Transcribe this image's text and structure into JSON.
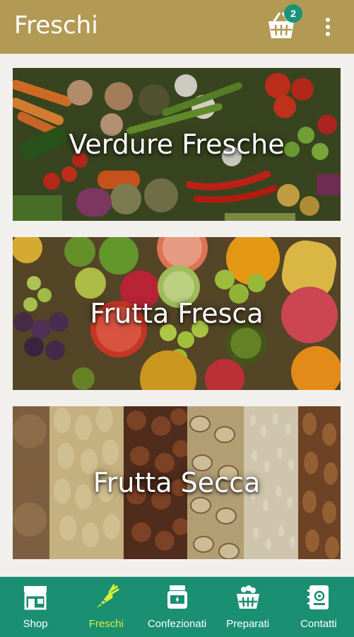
{
  "app": {
    "title": "Freschi"
  },
  "header": {
    "cart_icon": "basket-icon",
    "cart_count": "2",
    "menu_icon": "more-vertical-icon"
  },
  "categories": [
    {
      "label": "Verdure Fresche",
      "image": "vegetables-photo"
    },
    {
      "label": "Frutta Fresca",
      "image": "fruit-photo"
    },
    {
      "label": "Frutta Secca",
      "image": "nuts-photo"
    }
  ],
  "bottom_nav": {
    "items": [
      {
        "label": "Shop",
        "icon": "storefront-icon",
        "active": false
      },
      {
        "label": "Freschi",
        "icon": "carrot-icon",
        "active": true
      },
      {
        "label": "Confezionati",
        "icon": "jar-icon",
        "active": false
      },
      {
        "label": "Preparati",
        "icon": "basket-icon",
        "active": false
      },
      {
        "label": "Contatti",
        "icon": "address-book-icon",
        "active": false
      }
    ]
  },
  "colors": {
    "header_bg": "#b29a55",
    "nav_bg": "#1a8f72",
    "active_tab": "#d8f03a",
    "badge_bg": "#1a9479"
  }
}
